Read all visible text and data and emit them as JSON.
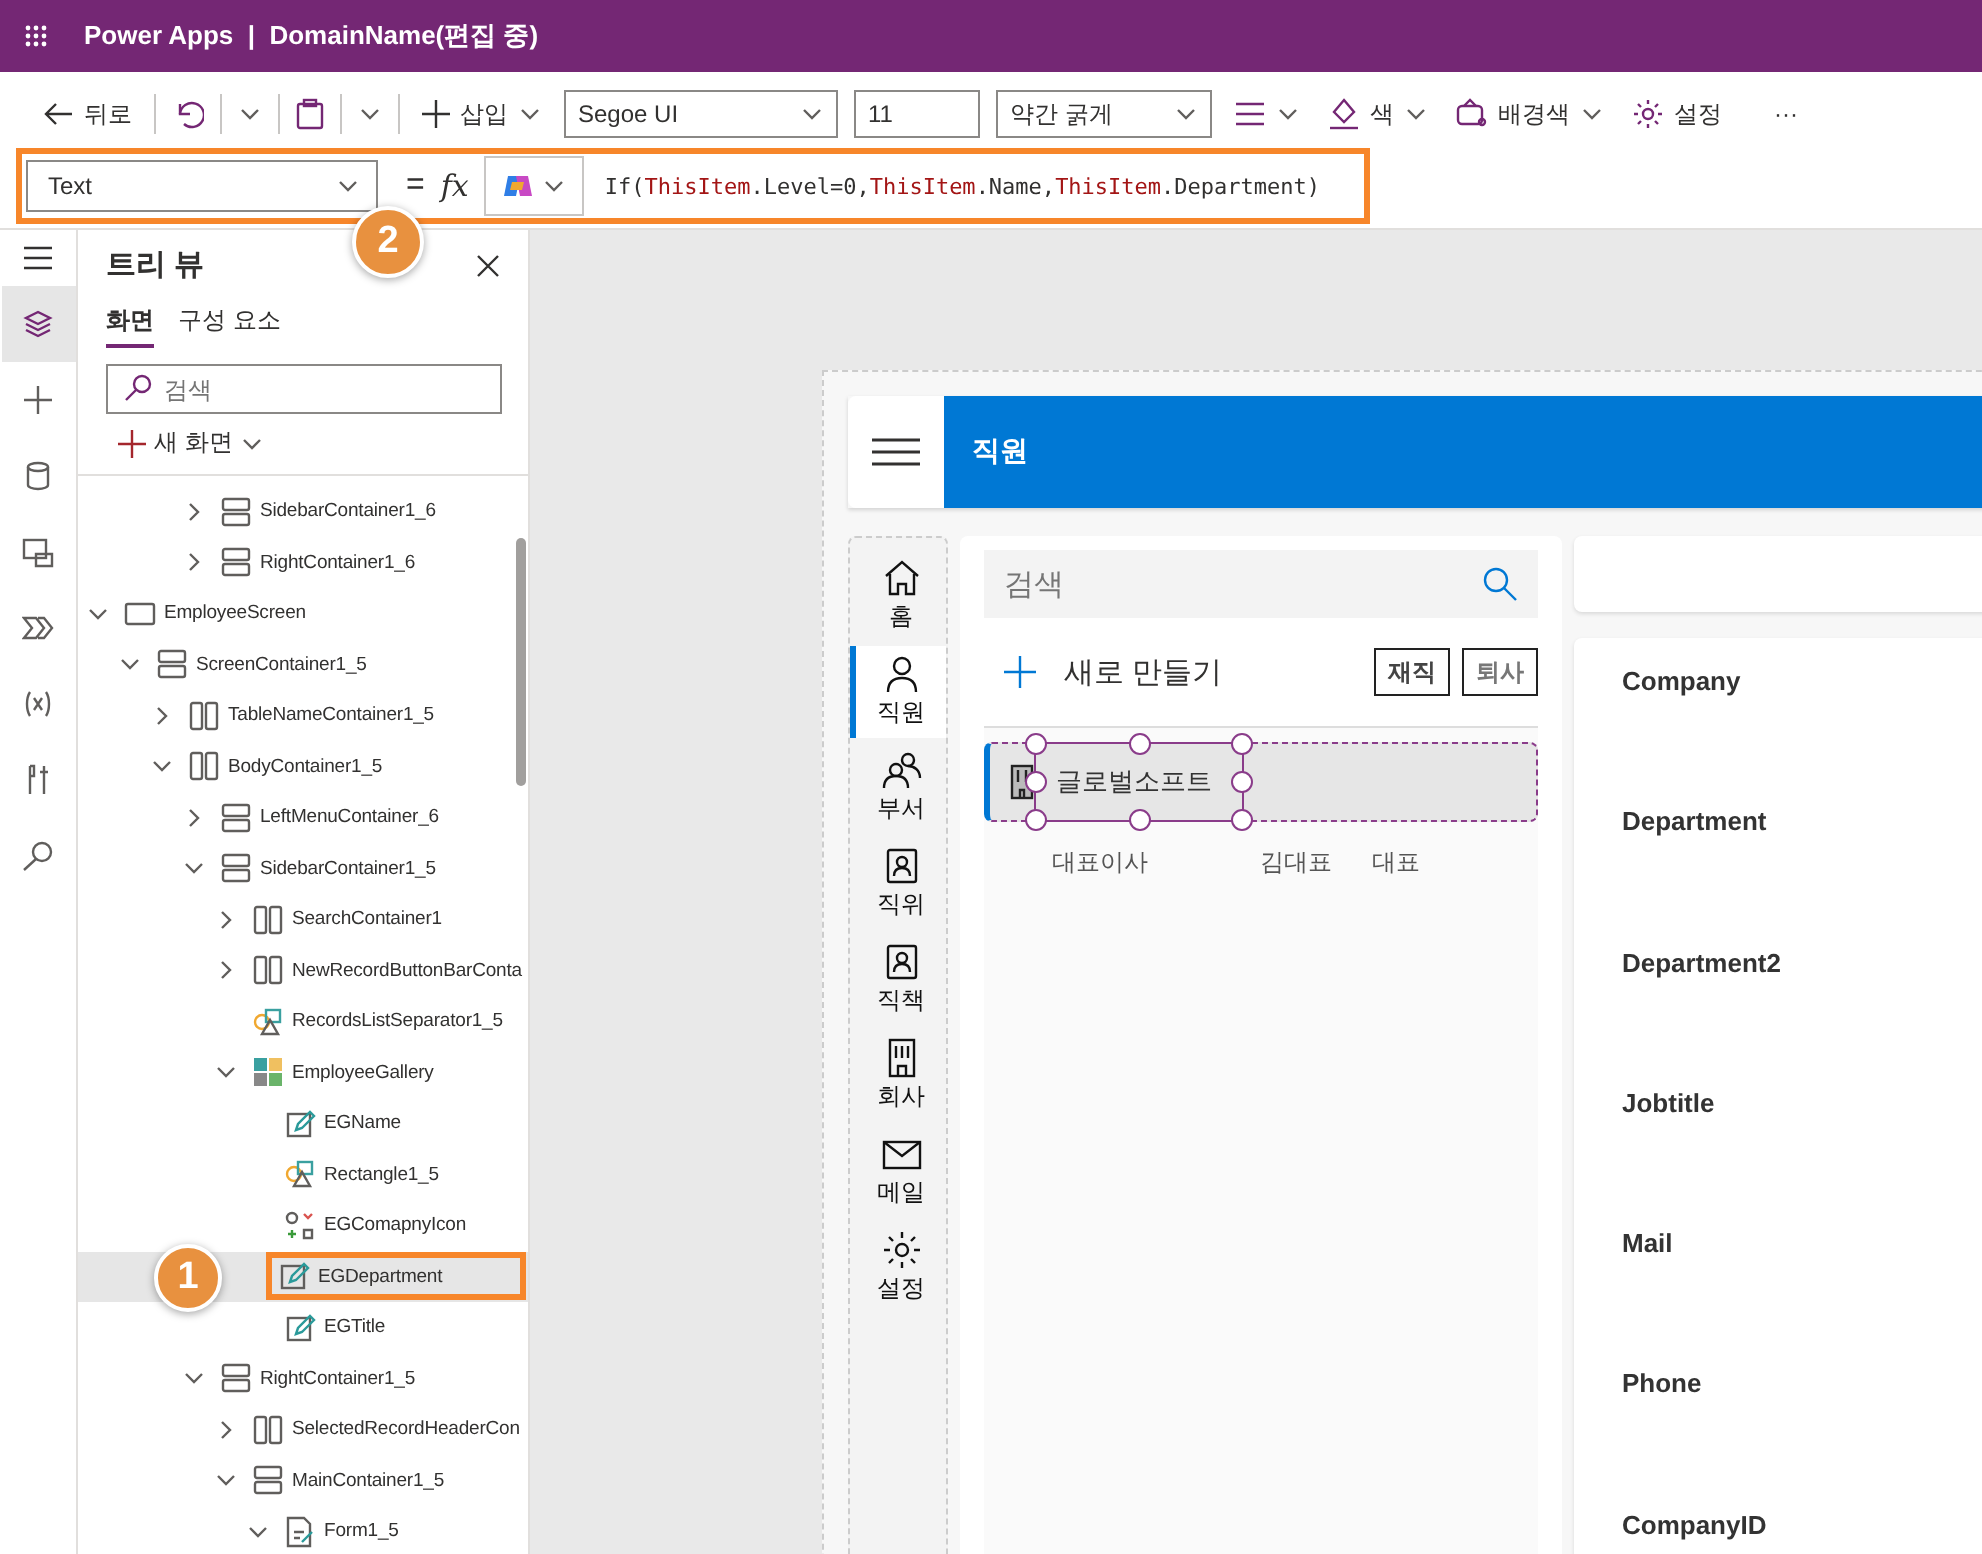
{
  "top_bar": {
    "title": "Power Apps  |  DomainName(편집 중)"
  },
  "toolbar": {
    "back": "뒤로",
    "insert": "삽입",
    "font": "Segoe UI",
    "font_size": "11",
    "font_weight": "약간 굵게",
    "color_label": "색",
    "fill_color_label": "배경색",
    "settings": "설정",
    "more": "···"
  },
  "formula_bar": {
    "property": "Text",
    "equals": "=",
    "fx": "fx",
    "callout": "2",
    "formula": [
      {
        "text": "If(",
        "kind": "plain"
      },
      {
        "text": "ThisItem",
        "kind": "record"
      },
      {
        "text": ".Level=0,",
        "kind": "plain"
      },
      {
        "text": "ThisItem",
        "kind": "record"
      },
      {
        "text": ".Name,",
        "kind": "plain"
      },
      {
        "text": "ThisItem",
        "kind": "record"
      },
      {
        "text": ".Department)",
        "kind": "plain"
      }
    ]
  },
  "rail": {
    "items": [
      {
        "selected": true
      },
      {
        "selected": false
      },
      {
        "selected": false
      },
      {
        "selected": false
      },
      {
        "selected": false
      },
      {
        "selected": false
      },
      {
        "selected": false
      },
      {
        "selected": false
      }
    ]
  },
  "tree_view": {
    "title": "트리 뷰",
    "tabs": [
      {
        "label": "화면",
        "selected": true
      },
      {
        "label": "구성 요소",
        "selected": false
      }
    ],
    "search": {
      "placeholder": "검색"
    },
    "new_screen": "새 화면",
    "partial_rows": [
      {
        "label": "SidebarContainer1_6",
        "kind": "vcontainer",
        "expanded": false,
        "selected": false
      },
      {
        "label": "RightContainer1_6",
        "kind": "vcontainer",
        "expanded": false,
        "selected": false
      }
    ],
    "items": [
      {
        "label": "EmployeeScreen",
        "kind": "screen",
        "expanded": true,
        "selected": false,
        "children": [
          {
            "label": "ScreenContainer1_5",
            "kind": "vcontainer",
            "expanded": true,
            "selected": false,
            "children": [
              {
                "label": "TableNameContainer1_5",
                "kind": "hcontainer",
                "expanded": false,
                "selected": false
              },
              {
                "label": "BodyContainer1_5",
                "kind": "hcontainer",
                "expanded": true,
                "selected": false,
                "children": [
                  {
                    "label": "LeftMenuContainer_6",
                    "kind": "vcontainer",
                    "expanded": false,
                    "selected": false
                  },
                  {
                    "label": "SidebarContainer1_5",
                    "kind": "vcontainer",
                    "expanded": true,
                    "selected": false,
                    "children": [
                      {
                        "label": "SearchContainer1",
                        "kind": "hcontainer",
                        "expanded": false,
                        "selected": false
                      },
                      {
                        "label": "NewRecordButtonBarConta",
                        "kind": "hcontainer",
                        "expanded": false,
                        "selected": false
                      },
                      {
                        "label": "RecordsListSeparator1_5",
                        "kind": "shape",
                        "selected": false
                      },
                      {
                        "label": "EmployeeGallery",
                        "kind": "gallery",
                        "expanded": true,
                        "selected": false,
                        "children": [
                          {
                            "label": "EGName",
                            "kind": "label",
                            "selected": false
                          },
                          {
                            "label": "Rectangle1_5",
                            "kind": "shape",
                            "selected": false
                          },
                          {
                            "label": "EGComapnyIcon",
                            "kind": "icon",
                            "selected": false
                          },
                          {
                            "label": "EGDepartment",
                            "kind": "label",
                            "selected": true,
                            "callout": "1"
                          },
                          {
                            "label": "EGTitle",
                            "kind": "label",
                            "selected": false
                          }
                        ]
                      }
                    ]
                  },
                  {
                    "label": "RightContainer1_5",
                    "kind": "vcontainer",
                    "expanded": true,
                    "selected": false,
                    "children": [
                      {
                        "label": "SelectedRecordHeaderCon",
                        "kind": "hcontainer",
                        "expanded": false,
                        "selected": false
                      },
                      {
                        "label": "MainContainer1_5",
                        "kind": "vcontainer",
                        "expanded": true,
                        "selected": false,
                        "children": [
                          {
                            "label": "Form1_5",
                            "kind": "form",
                            "expanded": true,
                            "selected": false
                          }
                        ]
                      }
                    ]
                  }
                ]
              }
            ]
          }
        ]
      }
    ]
  },
  "app": {
    "header": {
      "title": "직원"
    },
    "menu": [
      {
        "label": "홈",
        "selected": false
      },
      {
        "label": "직원",
        "selected": true
      },
      {
        "label": "부서",
        "selected": false
      },
      {
        "label": "직위",
        "selected": false
      },
      {
        "label": "직책",
        "selected": false
      },
      {
        "label": "회사",
        "selected": false
      },
      {
        "label": "메일",
        "selected": false
      },
      {
        "label": "설정",
        "selected": false
      }
    ],
    "search": {
      "placeholder": "검색"
    },
    "new_record": "새로 만들기",
    "filters": [
      {
        "label": "재직",
        "selected": true
      },
      {
        "label": "퇴사",
        "selected": false
      }
    ],
    "gallery": [
      {
        "company": "글로벌소프트",
        "details": [
          "대표이사",
          "김대표",
          "대표"
        ],
        "selected": true
      }
    ],
    "form_fields": [
      "Company",
      "Department",
      "Department2",
      "Jobtitle",
      "Mail",
      "Phone",
      "CompanyID"
    ]
  }
}
